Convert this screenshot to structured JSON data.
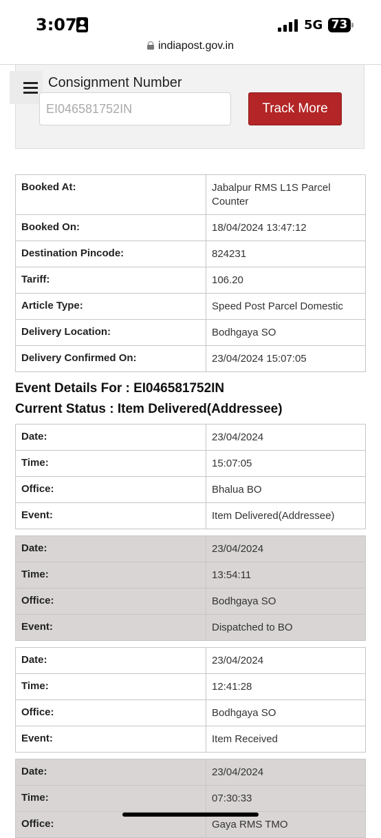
{
  "status_bar": {
    "time": "3:07",
    "network": "5G",
    "battery": "73"
  },
  "browser": {
    "url": "indiapost.gov.in"
  },
  "search": {
    "label": "Consignment Number",
    "placeholder": "EI046581752IN",
    "button_label": "Track More"
  },
  "booking_details": [
    {
      "label": "Booked At:",
      "value": "Jabalpur RMS L1S Parcel Counter"
    },
    {
      "label": "Booked On:",
      "value": "18/04/2024 13:47:12"
    },
    {
      "label": "Destination Pincode:",
      "value": "824231"
    },
    {
      "label": "Tariff:",
      "value": "106.20"
    },
    {
      "label": "Article Type:",
      "value": "Speed Post Parcel Domestic"
    },
    {
      "label": "Delivery Location:",
      "value": "Bodhgaya SO"
    },
    {
      "label": "Delivery Confirmed On:",
      "value": "23/04/2024 15:07:05"
    }
  ],
  "event_header": {
    "event_details": "Event Details For : EI046581752IN",
    "current_status": "Current Status : Item Delivered(Addressee)"
  },
  "field_labels": {
    "date": "Date:",
    "time": "Time:",
    "office": "Office:",
    "event": "Event:"
  },
  "events": [
    {
      "date": "23/04/2024",
      "time": "15:07:05",
      "office": "Bhalua BO",
      "event": "Item Delivered(Addressee)"
    },
    {
      "date": "23/04/2024",
      "time": "13:54:11",
      "office": "Bodhgaya SO",
      "event": "Dispatched to BO"
    },
    {
      "date": "23/04/2024",
      "time": "12:41:28",
      "office": "Bodhgaya SO",
      "event": "Item Received"
    },
    {
      "date": "23/04/2024",
      "time": "07:30:33",
      "office": "Gaya RMS TMO"
    }
  ]
}
